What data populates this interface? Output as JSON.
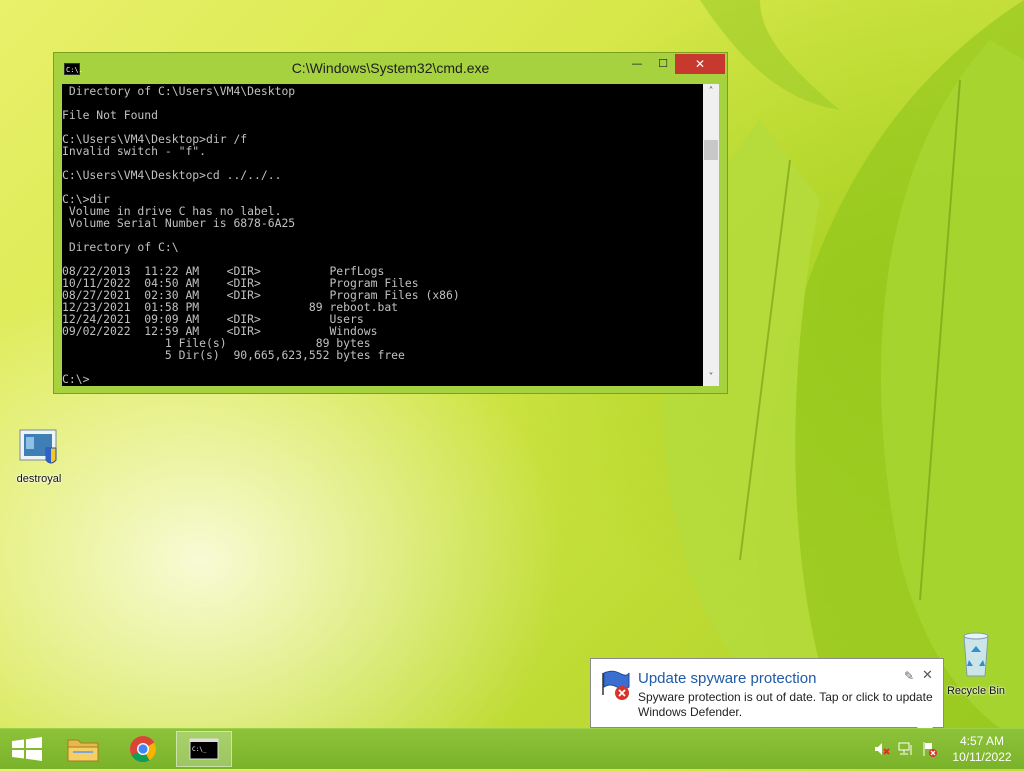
{
  "window": {
    "title": "C:\\Windows\\System32\\cmd.exe",
    "icon_text": "C:\\.",
    "minimize_glyph": "—",
    "maximize_glyph": "☐",
    "close_glyph": "✕"
  },
  "console": {
    "lines": [
      " Directory of C:\\Users\\VM4\\Desktop",
      "",
      "File Not Found",
      "",
      "C:\\Users\\VM4\\Desktop>dir /f",
      "Invalid switch - \"f\".",
      "",
      "C:\\Users\\VM4\\Desktop>cd ../../..",
      "",
      "C:\\>dir",
      " Volume in drive C has no label.",
      " Volume Serial Number is 6878-6A25",
      "",
      " Directory of C:\\",
      "",
      "08/22/2013  11:22 AM    <DIR>          PerfLogs",
      "10/11/2022  04:50 AM    <DIR>          Program Files",
      "08/27/2021  02:30 AM    <DIR>          Program Files (x86)",
      "12/23/2021  01:58 PM                89 reboot.bat",
      "12/24/2021  09:09 AM    <DIR>          Users",
      "09/02/2022  12:59 AM    <DIR>          Windows",
      "               1 File(s)             89 bytes",
      "               5 Dir(s)  90,665,623,552 bytes free",
      "",
      "C:\\>"
    ]
  },
  "desktop_icons": {
    "destroyal": "destroyal",
    "recycle_bin": "Recycle Bin"
  },
  "notification": {
    "title": "Update spyware protection",
    "body": "Spyware protection is out of date. Tap or click to update Windows Defender."
  },
  "taskbar": {
    "time": "4:57 AM",
    "date": "10/11/2022"
  },
  "colors": {
    "window_frame": "#a6d23f",
    "close_button": "#c7392f",
    "toast_title": "#1e5aa8",
    "taskbar": "#7ab22a"
  }
}
